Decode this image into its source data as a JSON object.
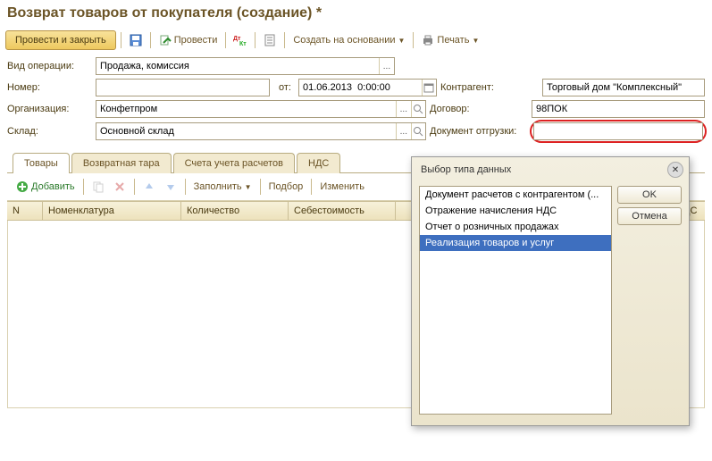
{
  "title": "Возврат товаров от покупателя (создание) *",
  "toolbar": {
    "main": "Провести и закрыть",
    "post": "Провести",
    "create_on_base": "Создать на основании",
    "print": "Печать"
  },
  "form": {
    "op_type_label": "Вид операции:",
    "op_type_value": "Продажа, комиссия",
    "number_label": "Номер:",
    "number_value": "",
    "from_label": "от:",
    "date_value": "01.06.2013  0:00:00",
    "org_label": "Организация:",
    "org_value": "Конфетпром",
    "warehouse_label": "Склад:",
    "warehouse_value": "Основной склад",
    "counterparty_label": "Контрагент:",
    "counterparty_value": "Торговый дом \"Комплексный\"",
    "contract_label": "Договор:",
    "contract_value": "98ПОК",
    "shipment_label": "Документ отгрузки:",
    "shipment_value": ""
  },
  "tabs": {
    "goods": "Товары",
    "tare": "Возвратная тара",
    "accounts": "Счета учета расчетов",
    "vat": "НДС"
  },
  "grid_toolbar": {
    "add": "Добавить",
    "fill": "Заполнить",
    "pick": "Подбор",
    "change": "Изменить"
  },
  "grid_headers": {
    "n": "N",
    "nomenclature": "Номенклатура",
    "quantity": "Количество",
    "cost": "Себестоимость",
    "vat_col": "ДС"
  },
  "dialog": {
    "title": "Выбор типа данных",
    "items": [
      "Документ расчетов с контрагентом (...",
      "Отражение начисления НДС",
      "Отчет о розничных продажах",
      "Реализация товаров и услуг"
    ],
    "ok": "OK",
    "cancel": "Отмена"
  }
}
